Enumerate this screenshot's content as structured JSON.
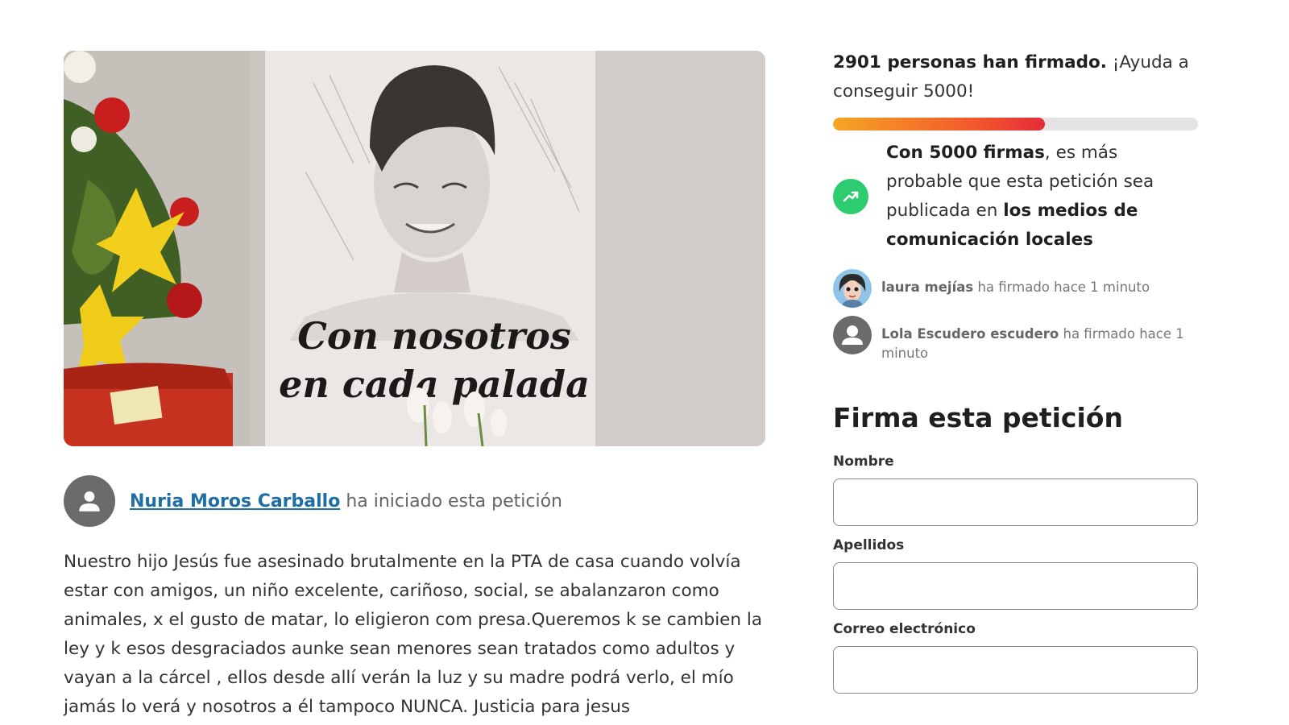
{
  "hero": {
    "caption_line1": "Con nosotros",
    "caption_line2": "en cada palada"
  },
  "starter": {
    "name": "Nuria Moros Carballo",
    "suffix": "ha iniciado esta petición"
  },
  "description": "Nuestro hijo Jesús fue asesinado brutalmente en la PTA de casa cuando volvía estar con amigos, un niño excelente, cariñoso, social, se abalanzaron como animales, x el gusto de matar, lo eligieron com presa.Queremos k se cambien la ley y k esos desgraciados aunke sean menores sean tratados como adultos y vayan a la cárcel , ellos desde allí verán la luz y su madre podrá verlo, el mío jamás lo verá y nosotros a él tampoco NUNCA. Justicia para jesus",
  "progress": {
    "count_bold": "2901 personas han firmado.",
    "count_rest": " ¡Ayuda a conseguir 5000!",
    "fraction": 0.58
  },
  "goal": {
    "bold1": "Con 5000 firmas",
    "text": ", es más probable que esta petición sea publicada en ",
    "bold2": "los medios de comunicación locales",
    "icon": "trending-up-icon",
    "color": "#2ecc71"
  },
  "signers": [
    {
      "name": "laura mejías",
      "action": " ha firmado hace 1 minuto"
    },
    {
      "name": "Lola Escudero escudero",
      "action": " ha firmado hace 1 minuto"
    }
  ],
  "form": {
    "title": "Firma esta petición",
    "fields": [
      {
        "label": "Nombre",
        "value": ""
      },
      {
        "label": "Apellidos",
        "value": ""
      },
      {
        "label": "Correo electrónico",
        "value": ""
      }
    ]
  },
  "colors": {
    "link": "#1d6fa5",
    "progress_start": "#f5a623",
    "progress_end": "#e52b3a",
    "goal_icon": "#2ecc71"
  }
}
